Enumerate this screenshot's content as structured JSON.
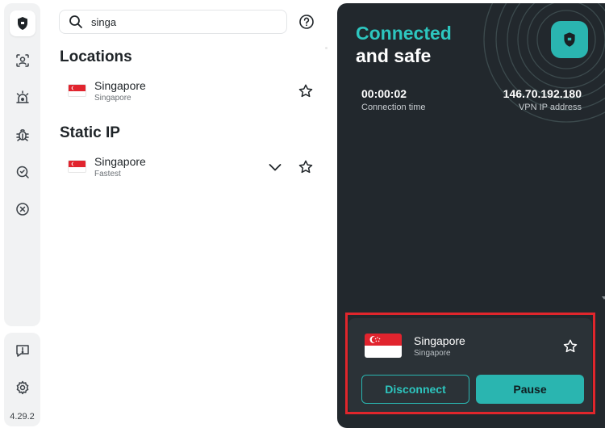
{
  "sidebar": {
    "version": "4.29.2",
    "items": [
      {
        "name": "vpn-shield",
        "icon": "shield-icon",
        "active": true
      },
      {
        "name": "identity",
        "icon": "user-scan-icon"
      },
      {
        "name": "alerts",
        "icon": "alarm-icon"
      },
      {
        "name": "antivirus",
        "icon": "bug-icon"
      },
      {
        "name": "scanner",
        "icon": "search-shield-icon"
      },
      {
        "name": "blocker",
        "icon": "block-icon"
      }
    ],
    "bottom_items": [
      {
        "name": "feedback",
        "icon": "chat-alert-icon"
      },
      {
        "name": "settings",
        "icon": "gear-icon"
      }
    ]
  },
  "search": {
    "value": "singa",
    "icon": "search-icon"
  },
  "help_icon": "question-circle-icon",
  "sections": {
    "locations": {
      "title": "Locations",
      "items": [
        {
          "name": "Singapore",
          "sub": "Singapore"
        }
      ]
    },
    "static_ip": {
      "title": "Static IP",
      "items": [
        {
          "name": "Singapore",
          "sub": "Fastest"
        }
      ]
    }
  },
  "status": {
    "line1": "Connected",
    "line2": "and safe",
    "time_value": "00:00:02",
    "time_label": "Connection time",
    "ip_value": "146.70.192.180",
    "ip_label": "VPN IP address"
  },
  "card": {
    "name": "Singapore",
    "sub": "Singapore",
    "disconnect_label": "Disconnect",
    "pause_label": "Pause"
  },
  "colors": {
    "accent": "#2ab5b0",
    "accent_text": "#2dc6bf",
    "dark_panel": "#22282d",
    "card": "#2b3237",
    "highlight": "#e0262c",
    "flag_red": "#e1242e"
  }
}
